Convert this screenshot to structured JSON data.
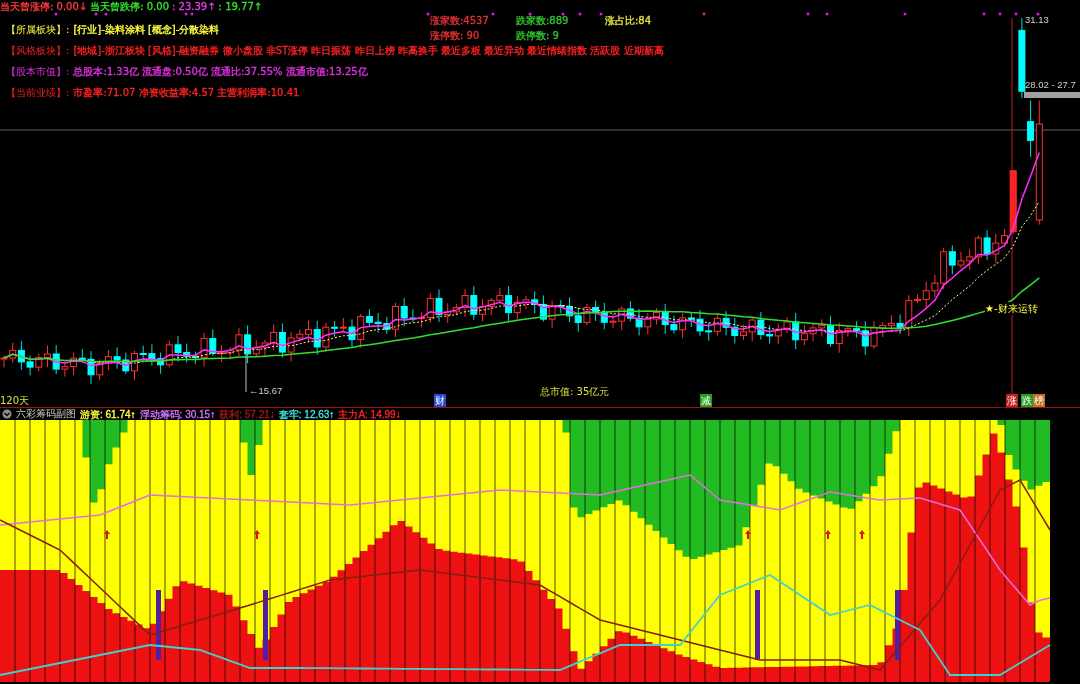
{
  "top_row": [
    {
      "label": "当天曾涨停:",
      "value": "0.00↓",
      "color": "#ff3a3a"
    },
    {
      "label": "当天曾跌停:",
      "value": "0.00",
      "color": "#30e030"
    },
    {
      "label": ":",
      "value": "23.39↑",
      "color": "#e040e0"
    },
    {
      "label": ":",
      "value": "19.77↑",
      "color": "#30e030"
    }
  ],
  "info_rows": [
    {
      "label": "【所属板块】:",
      "text": "[行业]-染料涂料 [概念]-分散染料",
      "color": "#ffff40"
    },
    {
      "label": "【风格板块】:",
      "text": "[地域]-浙江板块 [风格]-融资融券 微小盘股 非ST涨停 昨日振荡 昨日上榜 昨高换手 最近多板 最近异动 最近情绪指数 活跃股 近期新高",
      "color": "#ff2020"
    },
    {
      "label": "【股本市值】:",
      "text": "总股本:1.33亿 流通盘:0.50亿 流通比:37.55% 流通市值:13.25亿",
      "color": "#e030e0"
    },
    {
      "label": "【当前业绩】:",
      "text": "市盈率:71.07 净资收益率:4.57 主营利润率:10.41",
      "color": "#ff2020"
    }
  ],
  "market_stats": [
    {
      "text": "涨家数:4537",
      "color": "#e03030"
    },
    {
      "text": "跌家数:889",
      "color": "#30c030"
    },
    {
      "text": "涨占比:84",
      "color": "#e0e040"
    },
    {
      "text": "涨停数:       90",
      "color": "#e03030"
    },
    {
      "text": "跌停数:        9",
      "color": "#30c030"
    }
  ],
  "price_labels": {
    "high": "31.13",
    "range": "28.02 - 27.7",
    "low": "←15.67"
  },
  "signal_label": "★-财来运转",
  "period": "120天",
  "market_cap": "总市值: 35亿元",
  "event_markers": [
    {
      "text": "财",
      "color": "#2848c8"
    },
    {
      "text": "减",
      "color": "#20a020"
    },
    {
      "text": "涨",
      "color": "#c02020"
    },
    {
      "text": "跌",
      "color": "#20a020"
    },
    {
      "text": "榜",
      "color": "#c07020"
    }
  ],
  "indicator": {
    "title": "六彩筹码副图",
    "values": [
      {
        "label": "游资:",
        "value": "61.74↑",
        "color": "#ffff40"
      },
      {
        "label": "浮动筹码:",
        "value": "30.15↑",
        "color": "#d070ff"
      },
      {
        "label": "获利:",
        "value": "57.21↓",
        "color": "#a01818"
      },
      {
        "label": "套牢:",
        "value": "12.63↑",
        "color": "#40e0e0"
      },
      {
        "label": "主力A:",
        "value": "14.99↓",
        "color": "#ff2020"
      }
    ]
  }
}
